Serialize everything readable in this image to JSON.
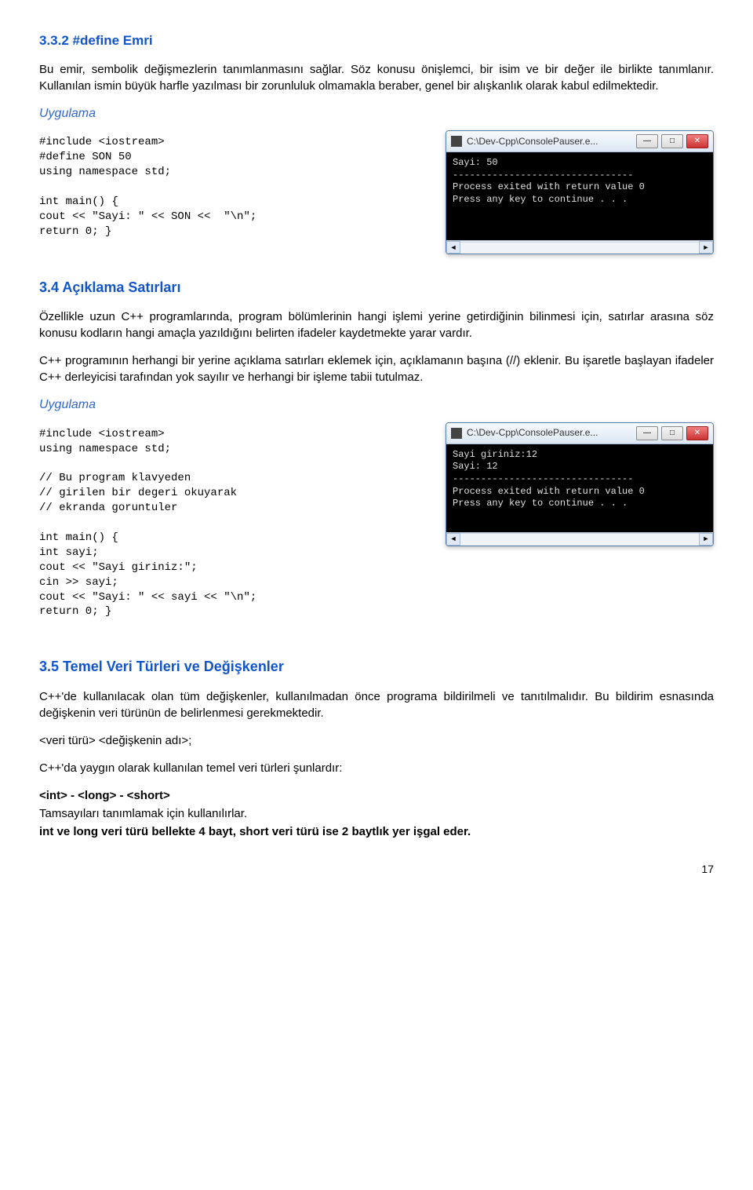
{
  "sec_332_heading": "3.3.2 #define Emri",
  "sec_332_p1": "Bu emir, sembolik değişmezlerin tanımlanmasını sağlar. Söz konusu önişlemci, bir isim ve bir değer ile birlikte tanımlanır. Kullanılan ismin büyük harfle yazılması bir zorunluluk olmamakla beraber, genel bir alışkanlık olarak kabul edilmektedir.",
  "uygulama_label": "Uygulama",
  "code1": "#include <iostream>\n#define SON 50\nusing namespace std;\n\nint main() {\ncout << \"Sayi: \" << SON <<  \"\\n\";\nreturn 0; }",
  "console1": {
    "title": "C:\\Dev-Cpp\\ConsolePauser.e...",
    "body": "Sayi: 50\n--------------------------------\nProcess exited with return value 0\nPress any key to continue . . ."
  },
  "sec_34_heading": "3.4 Açıklama Satırları",
  "sec_34_p1": "Özellikle uzun C++ programlarında, program bölümlerinin hangi işlemi yerine getirdiğinin bilinmesi için, satırlar arasına söz konusu kodların hangi amaçla yazıldığını belirten ifadeler kaydetmekte yarar vardır.",
  "sec_34_p2": "C++ programının herhangi bir yerine açıklama satırları eklemek için, açıklamanın başına (//) eklenir. Bu işaretle başlayan ifadeler C++ derleyicisi tarafından yok sayılır ve herhangi bir işleme tabii tutulmaz.",
  "code2": "#include <iostream>\nusing namespace std;\n\n// Bu program klavyeden\n// girilen bir degeri okuyarak\n// ekranda goruntuler\n\nint main() {\nint sayi;\ncout << \"Sayi giriniz:\";\ncin >> sayi;\ncout << \"Sayi: \" << sayi << \"\\n\";\nreturn 0; }",
  "console2": {
    "title": "C:\\Dev-Cpp\\ConsolePauser.e...",
    "body": "Sayi giriniz:12\nSayi: 12\n--------------------------------\nProcess exited with return value 0\nPress any key to continue . . ."
  },
  "sec_35_heading": "3.5 Temel Veri Türleri ve Değişkenler",
  "sec_35_p1": "C++'de kullanılacak olan tüm değişkenler, kullanılmadan önce programa bildirilmeli ve tanıtılmalıdır. Bu bildirim esnasında değişkenin veri türünün de belirlenmesi gerekmektedir.",
  "sec_35_decl": "<veri türü> <değişkenin adı>;",
  "sec_35_p2": "C++'da yaygın olarak kullanılan temel veri türleri şunlardır:",
  "sec_35_types": "<int> - <long> - <short>",
  "sec_35_p3": "Tamsayıları tanımlamak için kullanılırlar.",
  "sec_35_p4": "int ve long veri türü bellekte 4 bayt, short veri türü ise 2 baytlık yer işgal eder.",
  "page_number": "17"
}
